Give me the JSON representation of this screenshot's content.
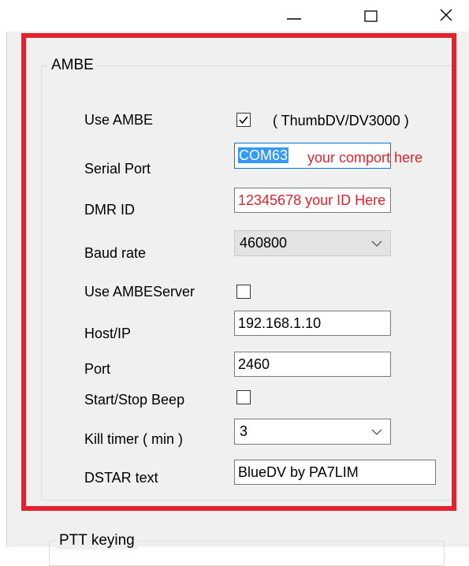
{
  "window": {
    "minimize_glyph": "—",
    "maximize_glyph": "☐",
    "close_glyph": "✕"
  },
  "ambe_group": {
    "title": "AMBE",
    "use_ambe": {
      "label": "Use AMBE",
      "checked": true,
      "note": "( ThumbDV/DV3000 )"
    },
    "serial_port": {
      "label": "Serial Port",
      "value": "COM63",
      "annotation": "your comport here"
    },
    "dmr_id": {
      "label": "DMR ID",
      "value": "12345678 your ID Here"
    },
    "baud_rate": {
      "label": "Baud rate",
      "value": "460800"
    },
    "use_ambeserver": {
      "label": "Use AMBEServer",
      "checked": false
    },
    "host_ip": {
      "label": "Host/IP",
      "value": "192.168.1.10"
    },
    "port": {
      "label": "Port",
      "value": "2460"
    },
    "start_stop_beep": {
      "label": "Start/Stop Beep",
      "checked": false
    },
    "kill_timer": {
      "label": "Kill timer ( min )",
      "value": "3"
    },
    "dstar_text": {
      "label": "DSTAR text",
      "value": "BlueDV by PA7LIM"
    }
  },
  "ptt_group": {
    "title": "PTT keying"
  },
  "colors": {
    "highlight": "#e4222d",
    "focus": "#0078d7",
    "selection": "#3399ff"
  }
}
